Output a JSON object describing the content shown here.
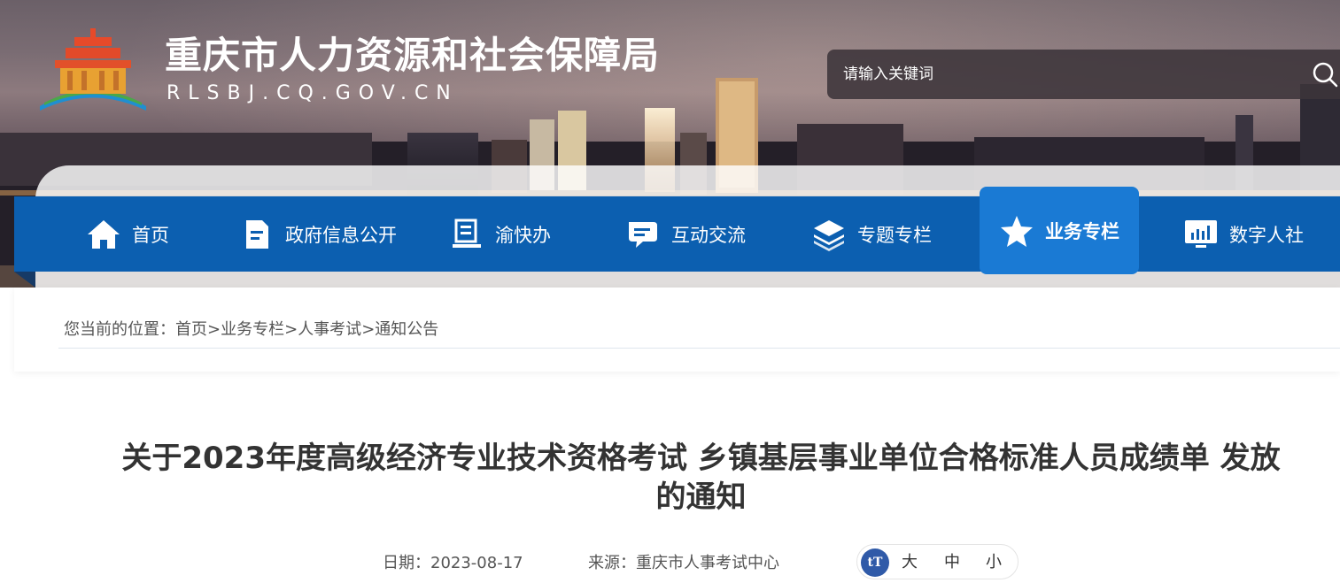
{
  "header": {
    "site_title": "重庆市人力资源和社会保障局",
    "site_domain": "RLSBJ.CQ.GOV.CN",
    "logo_icon": "tiantan-temple-logo-icon",
    "search": {
      "placeholder": "请输入关键词",
      "icon": "search-icon"
    }
  },
  "nav": {
    "items": [
      {
        "label": "首页",
        "icon": "home-icon",
        "active": false
      },
      {
        "label": "政府信息公开",
        "icon": "document-icon",
        "active": false
      },
      {
        "label": "渝快办",
        "icon": "book-icon",
        "active": false
      },
      {
        "label": "互动交流",
        "icon": "chat-icon",
        "active": false
      },
      {
        "label": "专题专栏",
        "icon": "layers-icon",
        "active": false
      },
      {
        "label": "业务专栏",
        "icon": "star-icon",
        "active": true
      },
      {
        "label": "数字人社",
        "icon": "monitor-chart-icon",
        "active": false
      }
    ],
    "colors": {
      "bar": "#0c5fb0",
      "active": "#1a7ad4"
    }
  },
  "breadcrumb": {
    "prefix": "您当前的位置：",
    "items": [
      "首页",
      "业务专栏",
      "人事考试",
      "通知公告"
    ],
    "separator": ">"
  },
  "article": {
    "title_line1": "关于2023年度高级经济专业技术资格考试 乡镇基层事业单位合格标准人员成绩单 发放",
    "title_line2": "的通知",
    "date_label": "日期：",
    "date": "2023-08-17",
    "source_label": "来源：",
    "source": "重庆市人事考试中心",
    "font_size": {
      "icon_text": "tT",
      "large": "大",
      "medium": "中",
      "small": "小"
    }
  }
}
